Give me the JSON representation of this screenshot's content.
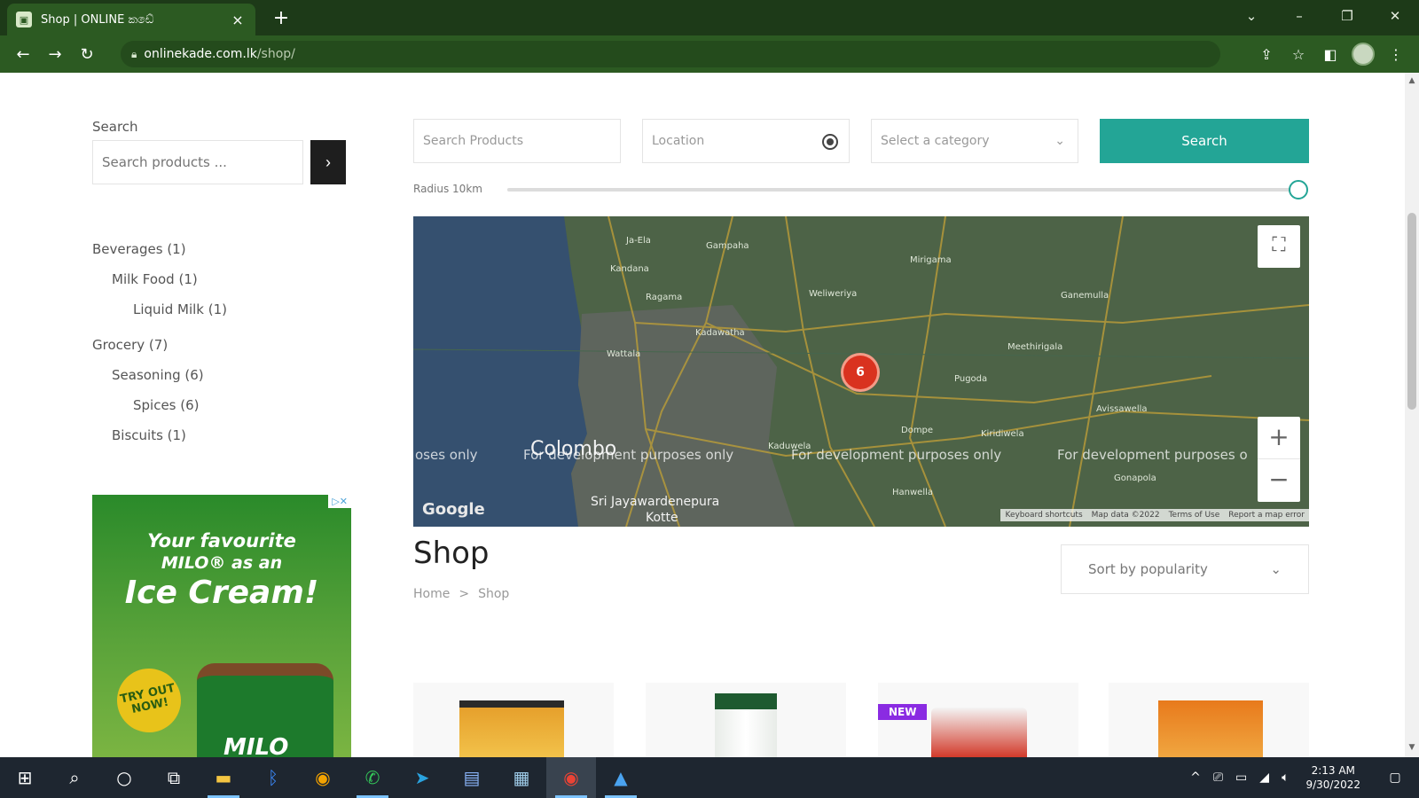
{
  "browser": {
    "tab_title": "Shop | ONLINE කඩේ",
    "tab_close": "×",
    "new_tab": "+",
    "url_host": "onlinekade.com.lk",
    "url_path": "/shop/",
    "nav": {
      "back": "←",
      "forward": "→",
      "reload": "↻"
    },
    "window_controls": {
      "dropdown": "⌄",
      "minimize": "–",
      "restore": "❐",
      "close": "✕"
    }
  },
  "sidebar": {
    "search_label": "Search",
    "search_placeholder": "Search products ...",
    "search_button": "›",
    "categories": [
      {
        "label": "Beverages (1)",
        "level": 0
      },
      {
        "label": "Milk Food (1)",
        "level": 1
      },
      {
        "label": "Liquid Milk (1)",
        "level": 2
      },
      {
        "label": "Grocery (7)",
        "level": 0
      },
      {
        "label": "Seasoning (6)",
        "level": 1
      },
      {
        "label": "Spices (6)",
        "level": 2
      },
      {
        "label": "Biscuits (1)",
        "level": 1
      }
    ]
  },
  "ad": {
    "close": "▷✕",
    "line1": "Your favourite",
    "line2": "MILO® as an",
    "line3": "Ice Cream!",
    "badge": "TRY OUT NOW!",
    "brand": "MILO"
  },
  "filters": {
    "search_placeholder": "Search Products",
    "location_placeholder": "Location",
    "category_placeholder": "Select a category",
    "category_chevron": "⌄",
    "search_button": "Search",
    "radius_label": "Radius 10km",
    "radius_value": 1.0
  },
  "map": {
    "cluster_count": "6",
    "fullscreen": "⛶",
    "zoom_in": "+",
    "zoom_out": "−",
    "google": "Google",
    "dev_watermark_partial": "oses only",
    "dev_watermark": "For development purposes only",
    "dev_watermark_cut": "For development purposes o",
    "city": "Colombo",
    "city2": "Sri Jayawardenepura",
    "city2b": "Kotte",
    "towns": [
      "Ja-Ela",
      "Gampaha",
      "Kandana",
      "Ragama",
      "Wattala",
      "Kadawatha",
      "Weliweriya",
      "Mirigama",
      "Ganemulla",
      "Meethirigala",
      "Pugoda",
      "Dompe",
      "Kaduwela",
      "Hanwella",
      "Kiridiwela",
      "Avissawella",
      "Gonapola"
    ],
    "footer": [
      "Keyboard shortcuts",
      "Map data ©2022",
      "Terms of Use",
      "Report a map error"
    ]
  },
  "shop": {
    "title": "Shop",
    "breadcrumb_home": "Home",
    "breadcrumb_sep": ">",
    "breadcrumb_current": "Shop",
    "sort_label": "Sort by popularity",
    "sort_chevron": "⌄",
    "new_badge": "NEW"
  },
  "taskbar": {
    "time": "2:13 AM",
    "date": "9/30/2022",
    "icons": [
      "windows-icon",
      "search-icon",
      "cortana-icon",
      "task-view-icon",
      "file-explorer-icon",
      "bluetooth-icon",
      "chrome-dev-icon",
      "whatsapp-icon",
      "telegram-icon",
      "app-icon",
      "notepad-icon",
      "chrome-icon",
      "photos-icon"
    ]
  },
  "colors": {
    "accent": "#23a596",
    "chrome_dark": "#1d3a18",
    "chrome": "#2c5a22",
    "marker": "#d9321f",
    "new_badge": "#8a2be2"
  }
}
